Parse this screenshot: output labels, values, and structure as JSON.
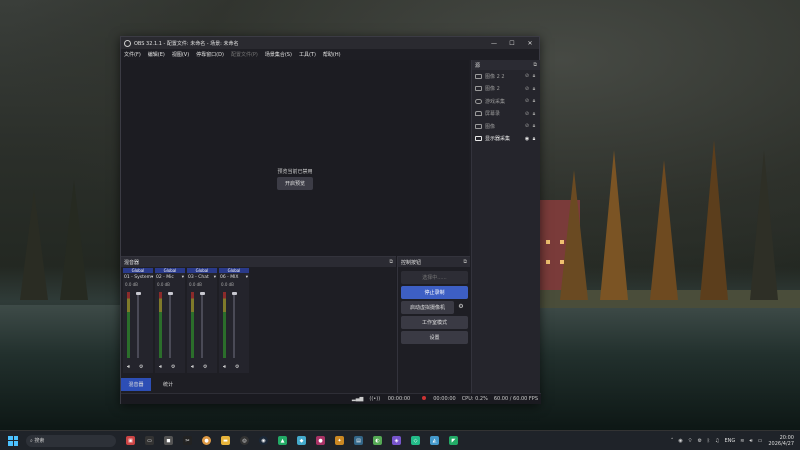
{
  "window": {
    "title": "OBS 32.1.1 - 配置文件: 未命名 - 场景: 未命名",
    "minimize": "—",
    "maximize": "☐",
    "close": "✕"
  },
  "menu": [
    {
      "label": "文件(F)",
      "enabled": true
    },
    {
      "label": "编辑(E)",
      "enabled": true
    },
    {
      "label": "视图(V)",
      "enabled": true
    },
    {
      "label": "停靠窗口(D)",
      "enabled": true
    },
    {
      "label": "配置文件(P)",
      "enabled": false
    },
    {
      "label": "场景集合(S)",
      "enabled": true
    },
    {
      "label": "工具(T)",
      "enabled": true
    },
    {
      "label": "帮助(H)",
      "enabled": true
    }
  ],
  "preview": {
    "message": "预览当前已禁用",
    "enable_button": "开启预览"
  },
  "sources": {
    "title": "源",
    "items": [
      {
        "name": "图像 2 2",
        "icon": "image-icon",
        "active": false
      },
      {
        "name": "图像 2",
        "icon": "image-icon",
        "active": false
      },
      {
        "name": "游戏采集",
        "icon": "gamepad-icon",
        "active": false
      },
      {
        "name": "屏幕录",
        "icon": "camera-icon",
        "active": false
      },
      {
        "name": "图像",
        "icon": "image-icon",
        "active": false
      },
      {
        "name": "显示器采集",
        "icon": "monitor-icon",
        "active": true
      }
    ]
  },
  "mixer": {
    "title": "混音器",
    "channels": [
      {
        "badge": "Global",
        "name": "01 - System",
        "db": "0.0 dB"
      },
      {
        "badge": "Global",
        "name": "02 - Mic",
        "db": "0.0 dB"
      },
      {
        "badge": "Global",
        "name": "03 - Chat",
        "db": "0.0 dB"
      },
      {
        "badge": "Global",
        "name": "06 - MIX",
        "db": "0.0 dB"
      }
    ],
    "tabs": [
      {
        "label": "混音器",
        "active": true
      },
      {
        "label": "统计",
        "active": false
      }
    ]
  },
  "controls": {
    "title": "控制按钮",
    "buttons": {
      "select": "选择中......",
      "stop_record": "停止录制",
      "virtual_cam": "启动虚拟摄像机",
      "studio_mode": "工作室模式",
      "settings": "设置"
    }
  },
  "status": {
    "stream_time": "00:00:00",
    "rec_time": "00:00:00",
    "cpu": "CPU: 0.2%",
    "fps": "60.00 / 60.00 FPS"
  },
  "taskbar": {
    "search_placeholder": "搜索",
    "lang": "ENG",
    "time": "20:00",
    "date": "2026/4/27"
  }
}
